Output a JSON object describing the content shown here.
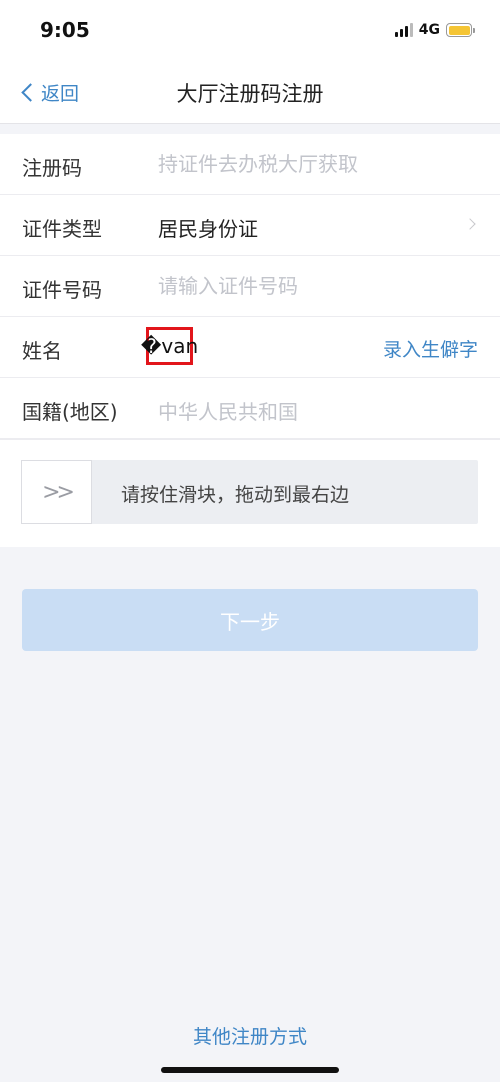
{
  "status_bar": {
    "time": "9:05",
    "network": "4G",
    "battery_color": "#f5c534"
  },
  "nav": {
    "back_label": "返回",
    "title": "大厅注册码注册"
  },
  "form": {
    "reg_code": {
      "label": "注册码",
      "placeholder": "持证件去办税大厅获取"
    },
    "id_type": {
      "label": "证件类型",
      "value": "居民身份证"
    },
    "id_number": {
      "label": "证件号码",
      "placeholder": "请输入证件号码"
    },
    "name": {
      "label": "姓名",
      "value": "�van",
      "rare_char_link": "录入生僻字"
    },
    "nationality": {
      "label": "国籍(地区)",
      "value": "中华人民共和国"
    }
  },
  "slider": {
    "handle_glyph": ">>",
    "hint": "请按住滑块，拖动到最右边"
  },
  "next_button": "下一步",
  "other_methods": "其他注册方式",
  "colors": {
    "accent": "#3f86c6",
    "highlight_border": "#e2151b",
    "disabled_button": "#c9ddf4"
  }
}
